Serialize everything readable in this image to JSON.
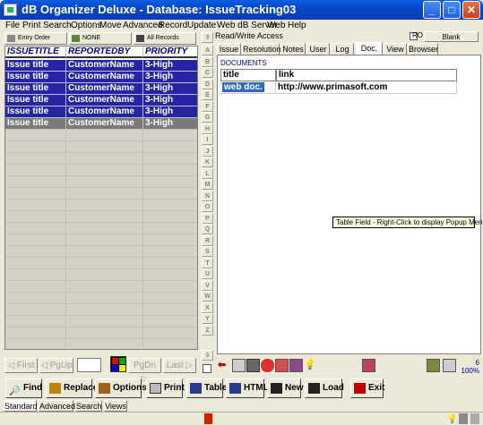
{
  "window": {
    "title": "dB Organizer Deluxe - Database: IssueTracking03"
  },
  "menu": [
    "File",
    "Print",
    "Search",
    "Options",
    "Move",
    "Advanced",
    "Record",
    "Update",
    "Web dB Server",
    "Web",
    "Help"
  ],
  "sortbar": {
    "entry_order": "Entry Order",
    "none": "NONE",
    "all_records": "All Records"
  },
  "grid": {
    "headers": [
      "ISSUETITLE",
      "REPORTEDBY",
      "PRIORITY"
    ],
    "rows": [
      [
        "Issue title",
        "CustomerName",
        "3-High"
      ],
      [
        "Issue title",
        "CustomerName",
        "3-High"
      ],
      [
        "Issue title",
        "CustomerName",
        "3-High"
      ],
      [
        "Issue title",
        "CustomerName",
        "3-High"
      ],
      [
        "Issue title",
        "CustomerName",
        "3-High"
      ],
      [
        "Issue title",
        "CustomerName",
        "3-High"
      ]
    ],
    "selected_row": 5
  },
  "nav": {
    "first": "First",
    "pgup": "PgUp",
    "pgdn": "PgDn",
    "last": "Last"
  },
  "alphabet": [
    "A",
    "B",
    "C",
    "D",
    "E",
    "F",
    "G",
    "H",
    "I",
    "J",
    "K",
    "L",
    "M",
    "N",
    "O",
    "P",
    "Q",
    "R",
    "S",
    "T",
    "U",
    "V",
    "W",
    "X",
    "Y",
    "Z"
  ],
  "access": {
    "label": "Read/Write Access",
    "ro": "RO",
    "blank": "Blank"
  },
  "tabs": [
    "Issue",
    "Resolution",
    "Notes",
    "User",
    "Log",
    "Doc.",
    "View",
    "Browser"
  ],
  "active_tab": "Doc.",
  "documents": {
    "section_label": "DOCUMENTS",
    "headers": [
      "title",
      "link"
    ],
    "rows": [
      [
        "web doc.",
        "http://www.primasoft.com"
      ]
    ]
  },
  "tooltip": "Table Field - Right-Click to display Popup Menu",
  "zoom": {
    "count": "6",
    "percent": "100%"
  },
  "toolbar": {
    "find": "Find",
    "replace": "Replace",
    "options": "Options",
    "print": "Print",
    "table": "Table",
    "html": "HTML",
    "new": "New",
    "load": "Load",
    "exit": "Exit"
  },
  "status_tabs": [
    "Standard",
    "Advanced",
    "Search",
    "Views"
  ],
  "colors": {
    "title_bar": "#0a46c8",
    "grid_row": "#2525a3",
    "grid_selected": "#7a7a7a",
    "link_highlight": "#316ac5"
  }
}
